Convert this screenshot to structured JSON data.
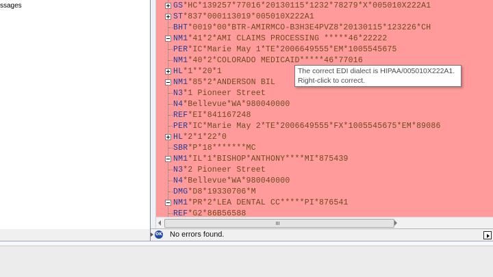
{
  "left_pane": {
    "item_text": "ssages"
  },
  "editor": {
    "segments": [
      {
        "id": "GS",
        "rest": "*HC*139257*77016*20130115*1232*78279*X*005010X222A1",
        "toggle": "plus"
      },
      {
        "id": "ST",
        "rest": "*837*000113019*005010X222A1",
        "toggle": "plus"
      },
      {
        "id": "BHT",
        "rest": "*0019*00*BTR-AMIRMCO-B3H3E4PVZ8*20130115*123226*CH",
        "toggle": "none"
      },
      {
        "id": "NM1",
        "rest": "*41*2*AMI CLAIMS PROCESSING *****46*22222",
        "toggle": "minus"
      },
      {
        "id": "PER",
        "rest": "*IC*Marie May 1*TE*2006649555*EM*1005545675",
        "toggle": "none"
      },
      {
        "id": "NM1",
        "rest": "*40*2*COLORADO MEDICAID*****46*77016",
        "toggle": "none"
      },
      {
        "id": "HL",
        "rest": "*1**20*1",
        "toggle": "plus"
      },
      {
        "id": "NM1",
        "rest": "*85*2*ANDERSON BIL",
        "toggle": "minus"
      },
      {
        "id": "N3",
        "rest": "*1 Pioneer Street",
        "toggle": "none"
      },
      {
        "id": "N4",
        "rest": "*Bellevue*WA*980040000",
        "toggle": "none"
      },
      {
        "id": "REF",
        "rest": "*EI*841167248",
        "toggle": "none"
      },
      {
        "id": "PER",
        "rest": "*IC*Marie May 2*TE*2006649555*FX*1005545675*EM*89086",
        "toggle": "none"
      },
      {
        "id": "HL",
        "rest": "*2*1*22*0",
        "toggle": "plus"
      },
      {
        "id": "SBR",
        "rest": "*P*18*******MC",
        "toggle": "none"
      },
      {
        "id": "NM1",
        "rest": "*IL*1*BISHOP*ANTHONY****MI*875439",
        "toggle": "minus"
      },
      {
        "id": "N3",
        "rest": "*2 Pioneer Street",
        "toggle": "none"
      },
      {
        "id": "N4",
        "rest": "*Bellevue*WA*980040000",
        "toggle": "none"
      },
      {
        "id": "DMG",
        "rest": "*D8*19330706*M",
        "toggle": "none"
      },
      {
        "id": "NM1",
        "rest": "*PR*2*LEA DENTAL CC*****PI*876541",
        "toggle": "minus"
      },
      {
        "id": "REF",
        "rest": "*G2*86B56588",
        "toggle": "none"
      }
    ]
  },
  "tooltip": {
    "line1": "The correct EDI dialect is HIPAA/005010X222A1.",
    "line2": "Right-click to correct."
  },
  "status": {
    "icon_text": "OK",
    "text": "No errors found."
  },
  "colors": {
    "error_background": "#ff9b9b",
    "segment_id": "#1f3d9a",
    "segment_data": "#6f4a1a",
    "status_icon": "#1f4aa8"
  }
}
